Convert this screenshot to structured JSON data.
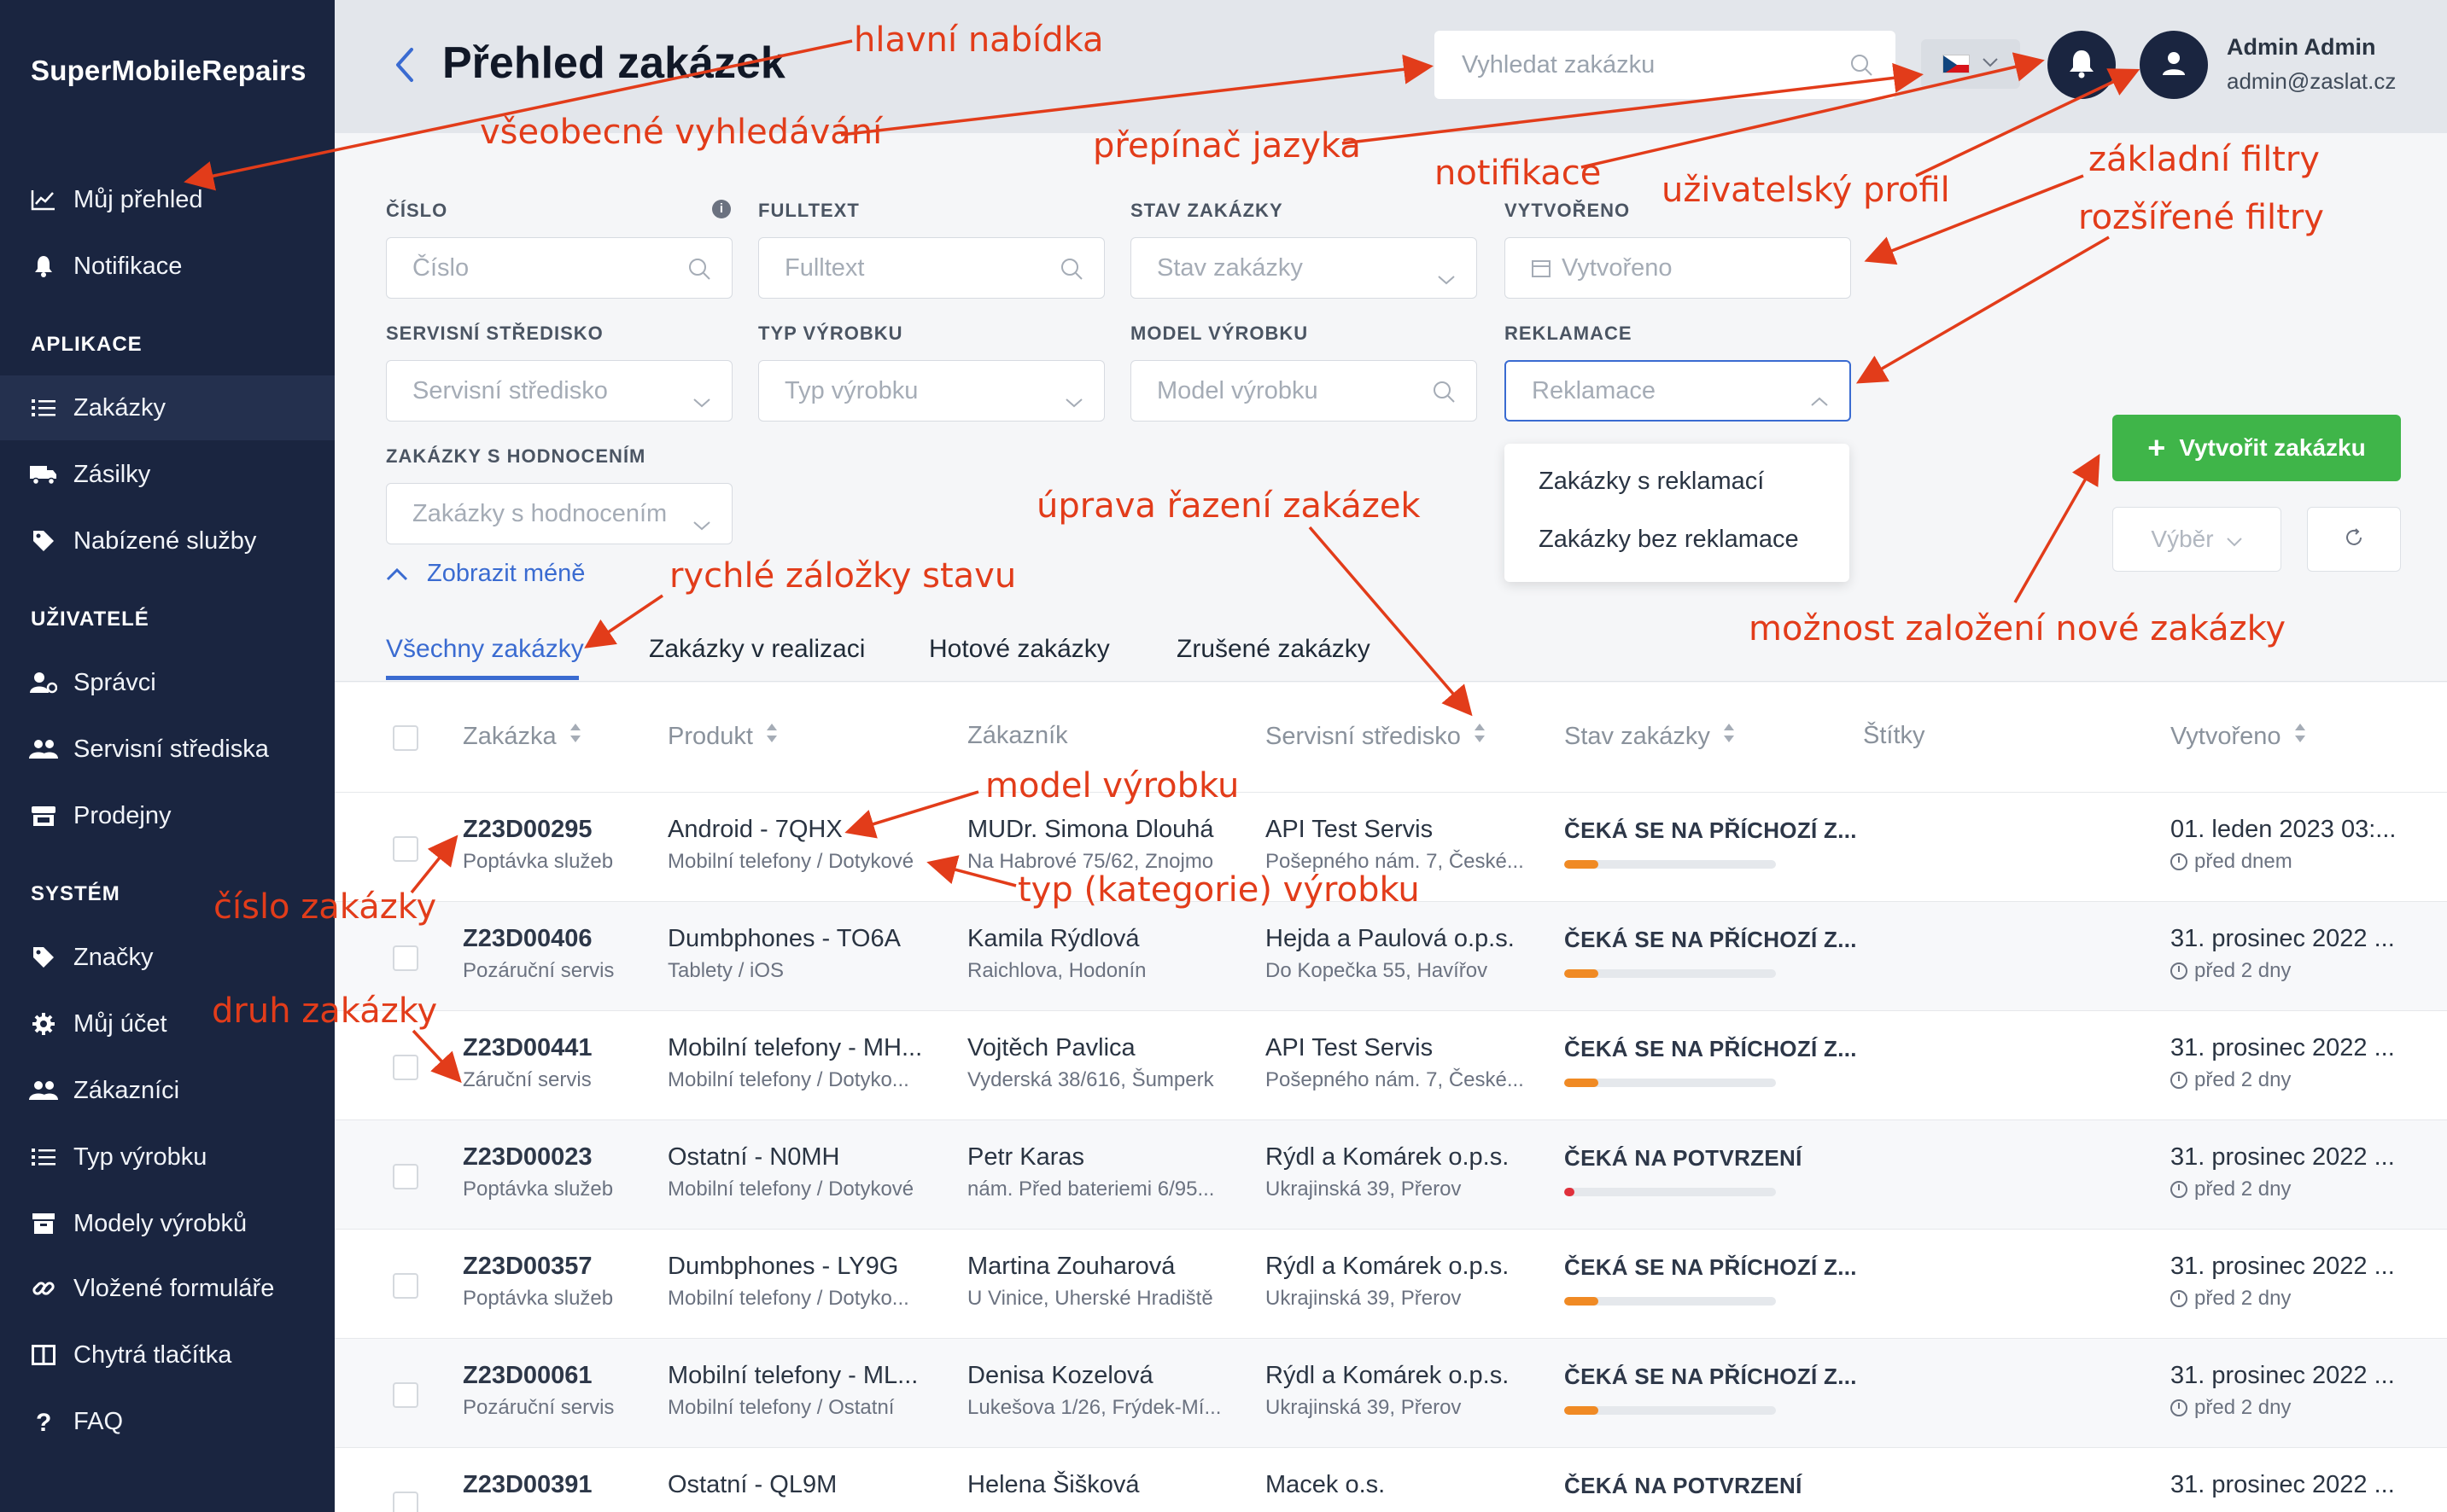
{
  "app": {
    "brand": "SuperMobileRepairs"
  },
  "sidebar": {
    "top_items": [
      {
        "label": "Můj přehled",
        "icon": "chart-line-icon"
      },
      {
        "label": "Notifikace",
        "icon": "bell-icon"
      }
    ],
    "sections": [
      {
        "title": "APLIKACE",
        "items": [
          {
            "label": "Zakázky",
            "icon": "list-icon",
            "active": true
          },
          {
            "label": "Zásilky",
            "icon": "truck-icon"
          },
          {
            "label": "Nabízené služby",
            "icon": "tag-icon"
          }
        ]
      },
      {
        "title": "UŽIVATELÉ",
        "items": [
          {
            "label": "Správci",
            "icon": "user-cog-icon"
          },
          {
            "label": "Servisní střediska",
            "icon": "users-icon"
          },
          {
            "label": "Prodejny",
            "icon": "store-icon"
          }
        ]
      },
      {
        "title": "SYSTÉM",
        "items": [
          {
            "label": "Značky",
            "icon": "tag-icon"
          },
          {
            "label": "Můj účet",
            "icon": "gear-icon"
          },
          {
            "label": "Zákazníci",
            "icon": "users-icon"
          },
          {
            "label": "Typ výrobku",
            "icon": "list-icon"
          },
          {
            "label": "Modely výrobků",
            "icon": "archive-icon"
          },
          {
            "label": "Vložené formuláře",
            "icon": "link-icon"
          },
          {
            "label": "Chytrá tlačítka",
            "icon": "columns-icon"
          },
          {
            "label": "FAQ",
            "icon": "question-icon"
          }
        ]
      }
    ]
  },
  "header": {
    "title": "Přehled zakázek",
    "search_placeholder": "Vyhledat zakázku",
    "language": "CZ",
    "user_name": "Admin Admin",
    "user_email": "admin@zaslat.cz"
  },
  "filters": {
    "cislo": {
      "label": "ČÍSLO",
      "placeholder": "Číslo"
    },
    "fulltext": {
      "label": "FULLTEXT",
      "placeholder": "Fulltext"
    },
    "stav": {
      "label": "STAV ZAKÁZKY",
      "placeholder": "Stav zakázky"
    },
    "vytvoreno": {
      "label": "VYTVOŘENO",
      "placeholder": "Vytvořeno"
    },
    "stredisko": {
      "label": "SERVISNÍ STŘEDISKO",
      "placeholder": "Servisní středisko"
    },
    "typ": {
      "label": "TYP VÝROBKU",
      "placeholder": "Typ výrobku"
    },
    "model": {
      "label": "MODEL VÝROBKU",
      "placeholder": "Model výrobku"
    },
    "reklamace": {
      "label": "REKLAMACE",
      "placeholder": "Reklamace",
      "options": [
        "Zakázky s reklamací",
        "Zakázky bez reklamace"
      ]
    },
    "hodnoceni": {
      "label": "ZAKÁZKY S HODNOCENÍM",
      "placeholder": "Zakázky s hodnocením"
    },
    "show_less": "Zobrazit méně"
  },
  "actions": {
    "create": "Vytvořit zakázku",
    "select": "Výběr"
  },
  "tabs": [
    "Všechny zakázky",
    "Zakázky v realizaci",
    "Hotové zakázky",
    "Zrušené zakázky"
  ],
  "table": {
    "headers": [
      "Zakázka",
      "Produkt",
      "Zákazník",
      "Servisní středisko",
      "Stav zakázky",
      "Štítky",
      "Vytvořeno"
    ],
    "rows": [
      {
        "id": "Z23D00295",
        "type": "Poptávka služeb",
        "product": "Android - 7QHX",
        "category": "Mobilní telefony / Dotykové",
        "customer": "MUDr. Simona Dlouhá",
        "address": "Na Habrové 75/62, Znojmo",
        "center": "API Test Servis",
        "center_addr": "Pošepného nám. 7, České...",
        "status": "ČEKÁ SE NA PŘÍCHOZÍ Z...",
        "progress": 0.16,
        "bar_color": "#f08a24",
        "created": "01. leden 2023 03:...",
        "ago": "před dnem"
      },
      {
        "id": "Z23D00406",
        "type": "Pozáruční servis",
        "product": "Dumbphones - TO6A",
        "category": "Tablety / iOS",
        "customer": "Kamila Rýdlová",
        "address": "Raichlova, Hodonín",
        "center": "Hejda a Paulová o.p.s.",
        "center_addr": "Do Kopečka 55, Havířov",
        "status": "ČEKÁ SE NA PŘÍCHOZÍ Z...",
        "progress": 0.16,
        "bar_color": "#f08a24",
        "created": "31. prosinec 2022 ...",
        "ago": "před 2 dny"
      },
      {
        "id": "Z23D00441",
        "type": "Záruční servis",
        "product": "Mobilní telefony - MH...",
        "category": "Mobilní telefony / Dotyko...",
        "customer": "Vojtěch Pavlica",
        "address": "Vyderská 38/616, Šumperk",
        "center": "API Test Servis",
        "center_addr": "Pošepného nám. 7, České...",
        "status": "ČEKÁ SE NA PŘÍCHOZÍ Z...",
        "progress": 0.16,
        "bar_color": "#f08a24",
        "created": "31. prosinec 2022 ...",
        "ago": "před 2 dny"
      },
      {
        "id": "Z23D00023",
        "type": "Poptávka služeb",
        "product": "Ostatní - N0MH",
        "category": "Mobilní telefony / Dotykové",
        "customer": "Petr Karas",
        "address": "nám. Před bateriemi 6/95...",
        "center": "Rýdl a Komárek o.p.s.",
        "center_addr": "Ukrajinská 39, Přerov",
        "status": "ČEKÁ NA POTVRZENÍ",
        "progress": 0.05,
        "bar_color": "#e0313c",
        "created": "31. prosinec 2022 ...",
        "ago": "před 2 dny"
      },
      {
        "id": "Z23D00357",
        "type": "Poptávka služeb",
        "product": "Dumbphones - LY9G",
        "category": "Mobilní telefony / Dotyko...",
        "customer": "Martina Zouharová",
        "address": "U Vinice, Uherské Hradiště",
        "center": "Rýdl a Komárek o.p.s.",
        "center_addr": "Ukrajinská 39, Přerov",
        "status": "ČEKÁ SE NA PŘÍCHOZÍ Z...",
        "progress": 0.16,
        "bar_color": "#f08a24",
        "created": "31. prosinec 2022 ...",
        "ago": "před 2 dny"
      },
      {
        "id": "Z23D00061",
        "type": "Pozáruční servis",
        "product": "Mobilní telefony - ML...",
        "category": "Mobilní telefony / Ostatní",
        "customer": "Denisa Kozelová",
        "address": "Lukešova 1/26, Frýdek-Mí...",
        "center": "Rýdl a Komárek o.p.s.",
        "center_addr": "Ukrajinská 39, Přerov",
        "status": "ČEKÁ SE NA PŘÍCHOZÍ Z...",
        "progress": 0.16,
        "bar_color": "#f08a24",
        "created": "31. prosinec 2022 ...",
        "ago": "před 2 dny"
      },
      {
        "id": "Z23D00391",
        "type": "",
        "product": "Ostatní - QL9M",
        "category": "",
        "customer": "Helena Šišková",
        "address": "",
        "center": "Macek o.s.",
        "center_addr": "",
        "status": "ČEKÁ NA POTVRZENÍ",
        "progress": 0.0,
        "bar_color": "#e0313c",
        "created": "31. prosinec 2022 ...",
        "ago": ""
      }
    ]
  },
  "annotations": {
    "hlavni_nabidka": "hlavní nabídka",
    "vyhledavani": "všeobecné vyhledávání",
    "jazyk": "přepínač jazyka",
    "notifikace": "notifikace",
    "profil": "uživatelský profil",
    "zakladni_filtry": "základní filtry",
    "rozsirene_filtry": "rozšířené filtry",
    "razeni": "úprava řazení zakázek",
    "zalozky": "rychlé záložky stavu",
    "nova_zakazka": "možnost založení nové zakázky",
    "model": "model výrobku",
    "typ": "typ (kategorie) výrobku",
    "cislo": "číslo zakázky",
    "druh": "druh zakázky"
  }
}
